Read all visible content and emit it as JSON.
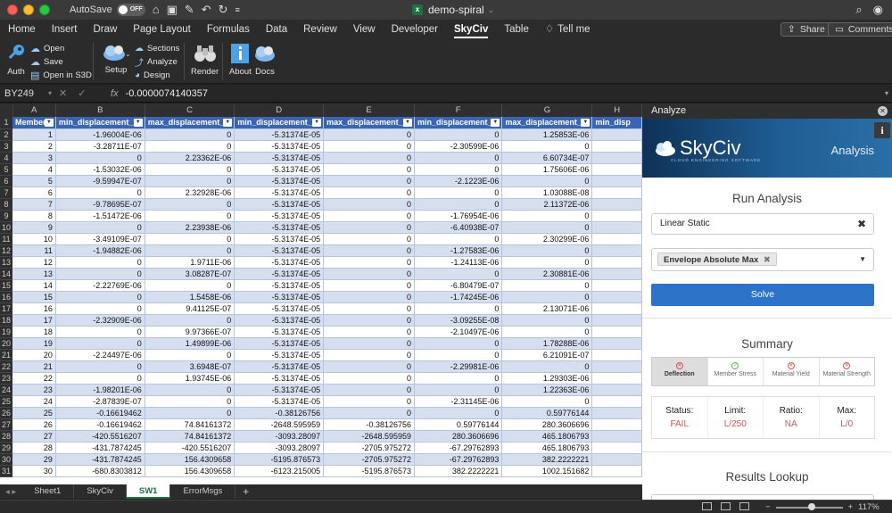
{
  "titlebar": {
    "autosave_label": "AutoSave",
    "autosave_state": "OFF",
    "doc_title": "demo-spiral",
    "traffic_colors": [
      "#ff5f57",
      "#febc2e",
      "#28c840"
    ]
  },
  "menu": {
    "tabs": [
      "Home",
      "Insert",
      "Draw",
      "Page Layout",
      "Formulas",
      "Data",
      "Review",
      "View",
      "Developer",
      "SkyCiv",
      "Table",
      "Tell me"
    ],
    "active": "SkyCiv",
    "share_label": "Share",
    "comments_label": "Comments"
  },
  "ribbon": {
    "auth": "Auth",
    "open": "Open",
    "save": "Save",
    "open_s3d": "Open in S3D",
    "setup": "Setup",
    "sections": "Sections",
    "analyze": "Analyze",
    "design": "Design",
    "render": "Render",
    "about": "About",
    "docs": "Docs"
  },
  "formula_bar": {
    "cell_ref": "BY249",
    "fx": "fx",
    "value": "-0.0000074140357"
  },
  "sheet": {
    "column_letters": [
      "A",
      "B",
      "C",
      "D",
      "E",
      "F",
      "G",
      "H"
    ],
    "headers": [
      "Member",
      "min_displacement_x",
      "max_displacement_x",
      "min_displacement_y",
      "max_displacement_y",
      "min_displacement_z",
      "max_displacement_z",
      "min_disp"
    ],
    "rows": [
      [
        "1",
        "-1.96004E-06",
        "0",
        "-5.31374E-05",
        "0",
        "0",
        "1.25853E-06",
        ""
      ],
      [
        "2",
        "-3.28711E-07",
        "0",
        "-5.31374E-05",
        "0",
        "-2.30599E-06",
        "0",
        ""
      ],
      [
        "3",
        "0",
        "2.23362E-06",
        "-5.31374E-05",
        "0",
        "0",
        "6.60734E-07",
        ""
      ],
      [
        "4",
        "-1.53032E-06",
        "0",
        "-5.31374E-05",
        "0",
        "0",
        "1.75606E-06",
        ""
      ],
      [
        "5",
        "-9.59947E-07",
        "0",
        "-5.31374E-05",
        "0",
        "-2.1223E-06",
        "0",
        ""
      ],
      [
        "6",
        "0",
        "2.32928E-06",
        "-5.31374E-05",
        "0",
        "0",
        "1.03088E-08",
        ""
      ],
      [
        "7",
        "-9.78695E-07",
        "0",
        "-5.31374E-05",
        "0",
        "0",
        "2.11372E-06",
        ""
      ],
      [
        "8",
        "-1.51472E-06",
        "0",
        "-5.31374E-05",
        "0",
        "-1.76954E-06",
        "0",
        ""
      ],
      [
        "9",
        "0",
        "2.23938E-06",
        "-5.31374E-05",
        "0",
        "-6.40938E-07",
        "0",
        ""
      ],
      [
        "10",
        "-3.49109E-07",
        "0",
        "-5.31374E-05",
        "0",
        "0",
        "2.30299E-06",
        ""
      ],
      [
        "11",
        "-1.94882E-06",
        "0",
        "-5.31374E-05",
        "0",
        "-1.27583E-06",
        "0",
        ""
      ],
      [
        "12",
        "0",
        "1.9711E-06",
        "-5.31374E-05",
        "0",
        "-1.24113E-06",
        "0",
        ""
      ],
      [
        "13",
        "0",
        "3.08287E-07",
        "-5.31374E-05",
        "0",
        "0",
        "2.30881E-06",
        ""
      ],
      [
        "14",
        "-2.22769E-06",
        "0",
        "-5.31374E-05",
        "0",
        "-6.80479E-07",
        "0",
        ""
      ],
      [
        "15",
        "0",
        "1.5458E-06",
        "-5.31374E-05",
        "0",
        "-1.74245E-06",
        "0",
        ""
      ],
      [
        "16",
        "0",
        "9.41125E-07",
        "-5.31374E-05",
        "0",
        "0",
        "2.13071E-06",
        ""
      ],
      [
        "17",
        "-2.32909E-06",
        "0",
        "-5.31374E-05",
        "0",
        "-3.09255E-08",
        "0",
        ""
      ],
      [
        "18",
        "0",
        "9.97366E-07",
        "-5.31374E-05",
        "0",
        "-2.10497E-06",
        "0",
        ""
      ],
      [
        "19",
        "0",
        "1.49899E-06",
        "-5.31374E-05",
        "0",
        "0",
        "1.78288E-06",
        ""
      ],
      [
        "20",
        "-2.24497E-06",
        "0",
        "-5.31374E-05",
        "0",
        "0",
        "6.21091E-07",
        ""
      ],
      [
        "21",
        "0",
        "3.6948E-07",
        "-5.31374E-05",
        "0",
        "-2.29981E-06",
        "0",
        ""
      ],
      [
        "22",
        "0",
        "1.93745E-06",
        "-5.31374E-05",
        "0",
        "0",
        "1.29303E-06",
        ""
      ],
      [
        "23",
        "-1.98201E-06",
        "0",
        "-5.31374E-05",
        "0",
        "0",
        "1.22363E-06",
        ""
      ],
      [
        "24",
        "-2.87839E-07",
        "0",
        "-5.31374E-05",
        "0",
        "-2.31145E-06",
        "0",
        ""
      ],
      [
        "25",
        "-0.16619462",
        "0",
        "-0.38126756",
        "0",
        "0",
        "0.59776144",
        ""
      ],
      [
        "26",
        "-0.16619462",
        "74.84161372",
        "-2648.595959",
        "-0.38126756",
        "0.59776144",
        "280.3606696",
        ""
      ],
      [
        "27",
        "-420.5516207",
        "74.84161372",
        "-3093.28097",
        "-2648.595959",
        "280.3606696",
        "465.1806793",
        ""
      ],
      [
        "28",
        "-431.7874245",
        "-420.5516207",
        "-3093.28097",
        "-2705.975272",
        "-67.29762893",
        "465.1806793",
        ""
      ],
      [
        "29",
        "-431.7874245",
        "156.4309658",
        "-5195.876573",
        "-2705.975272",
        "-67.29762893",
        "382.2222221",
        ""
      ],
      [
        "30",
        "-680.8303812",
        "156.4309658",
        "-6123.215005",
        "-5195.876573",
        "382.2222221",
        "1002.151682",
        ""
      ]
    ],
    "tabs": [
      "Sheet1",
      "SkyCiv",
      "SW1",
      "ErrorMsgs"
    ],
    "active_tab": "SW1",
    "header_color": "#3a65b4",
    "band_color": "#d6dff0"
  },
  "status": {
    "zoom": "117%",
    "zoom_fraction": 0.55
  },
  "panel": {
    "title": "Analyze",
    "brand": "SkyCiv",
    "brand_tagline": "CLOUD ENGINEERING SOFTWARE",
    "mode": "Analysis",
    "run_title": "Run Analysis",
    "analysis_type": "Linear Static",
    "envelope": "Envelope Absolute Max",
    "solve_label": "Solve",
    "summary_title": "Summary",
    "summary_tabs": [
      {
        "label": "Deflection",
        "status": "fail"
      },
      {
        "label": "Member Stress",
        "status": "pass"
      },
      {
        "label": "Material Yield",
        "status": "fail"
      },
      {
        "label": "Material Strength",
        "status": "fail"
      }
    ],
    "status_label": "Status:",
    "status_value": "FAIL",
    "limit_label": "Limit:",
    "limit_value": "L/250",
    "ratio_label": "Ratio:",
    "ratio_value": "NA",
    "max_label": "Max:",
    "max_value": "L/0",
    "lookup_title": "Results Lookup",
    "fail_color": "#d9534f",
    "accent_color": "#2d73c7"
  }
}
